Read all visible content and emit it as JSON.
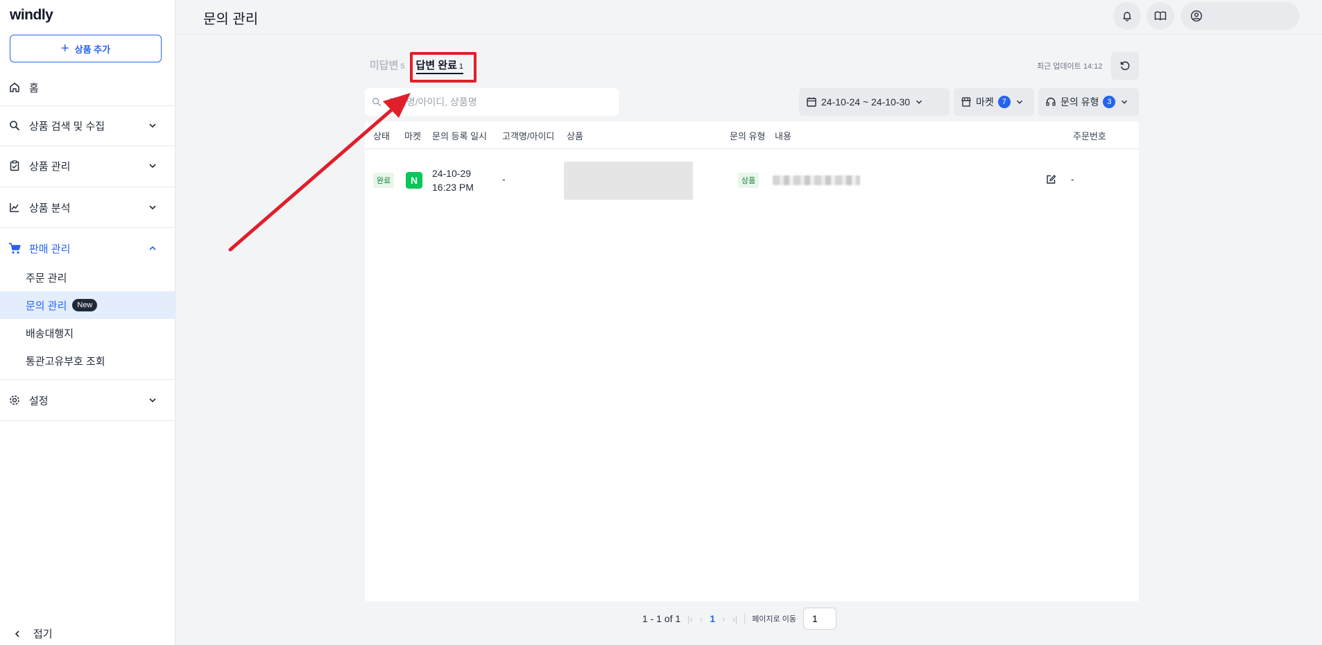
{
  "app": {
    "logo": "windly",
    "page_title": "문의 관리"
  },
  "sidebar": {
    "add_button": "상품 추가",
    "home": "홈",
    "groups": [
      {
        "label": "상품 검색 및 수집"
      },
      {
        "label": "상품 관리"
      },
      {
        "label": "상품 분석"
      },
      {
        "label": "판매 관리"
      }
    ],
    "sales_items": [
      {
        "label": "주문 관리"
      },
      {
        "label": "문의 관리",
        "badge": "New"
      },
      {
        "label": "배송대행지"
      },
      {
        "label": "통관고유부호 조회"
      }
    ],
    "settings": "설정",
    "collapse": "접기"
  },
  "tabs": {
    "unanswered": {
      "label": "미답변",
      "count": "5"
    },
    "answered": {
      "label": "답변 완료",
      "count": "1"
    }
  },
  "update_text": "최근 업데이트 14:12",
  "search": {
    "placeholder": "고객명/아이디, 상품명",
    "value": ""
  },
  "filters": {
    "date_range": "24-10-24 ~ 24-10-30",
    "market": {
      "label": "마켓",
      "count": "7"
    },
    "inquiry_type": {
      "label": "문의 유형",
      "count": "3"
    }
  },
  "table": {
    "headers": {
      "status": "상태",
      "market": "마켓",
      "date": "문의 등록 일시",
      "customer": "고객명/아이디",
      "product": "상품",
      "type": "문의 유형",
      "content": "내용",
      "order": "주문번호"
    },
    "rows": [
      {
        "status": "완료",
        "market_icon": "N",
        "date_line1": "24-10-29",
        "date_line2": "16:23 PM",
        "customer": "-",
        "type": "상품",
        "order": "-"
      }
    ]
  },
  "pagination": {
    "range": "1 - 1 of 1",
    "current": "1",
    "goto_label": "페이지로 이동",
    "goto_value": "1"
  },
  "colors": {
    "accent": "#2563eb",
    "highlight": "#e01f2b",
    "success": "#16803c"
  }
}
